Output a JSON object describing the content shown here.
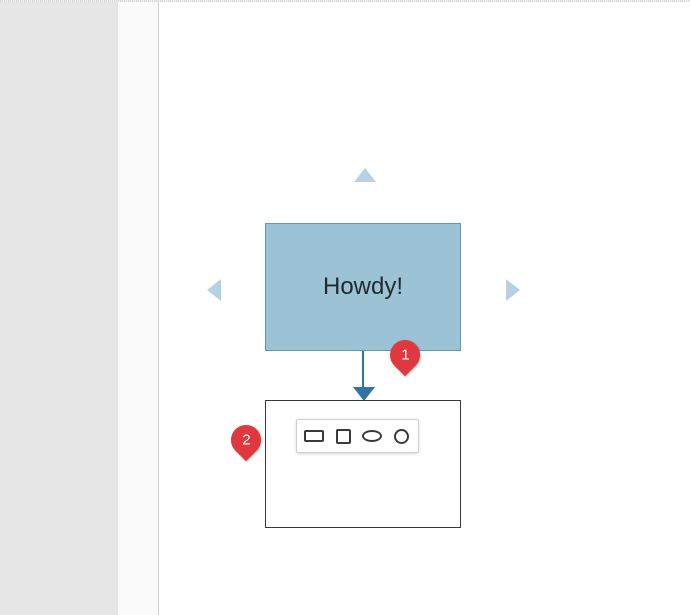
{
  "shape": {
    "text": "Howdy!"
  },
  "toolbar": {
    "options": [
      "rectangle",
      "square",
      "ellipse",
      "circle"
    ]
  },
  "callouts": {
    "one": "1",
    "two": "2"
  }
}
